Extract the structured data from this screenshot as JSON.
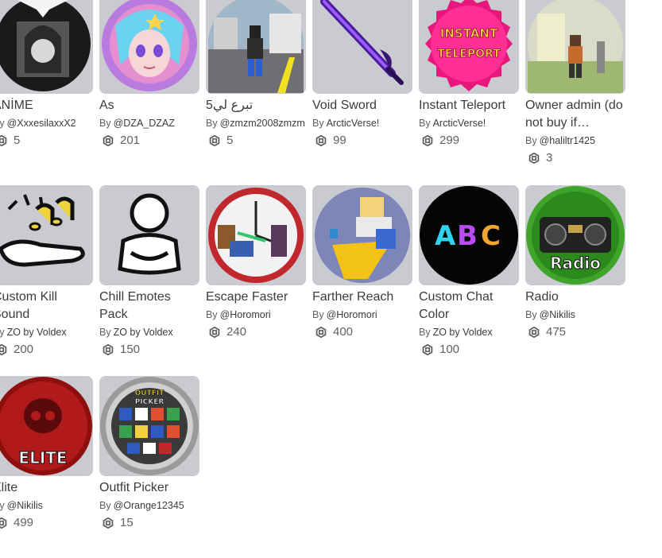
{
  "colors": {
    "thumb_bg": "#c9cbd1",
    "text_primary": "#393b3d",
    "text_secondary": "#606162"
  },
  "currency_icon": "robux-icon",
  "items": [
    {
      "title": "ANİME",
      "by": "By",
      "creator": "@XxxesilaxxX2",
      "price": "5",
      "thumb": "anime-girl-image"
    },
    {
      "title": "As",
      "by": "By",
      "creator": "@DZA_DZAZ",
      "price": "201",
      "thumb": "anime-portrait-image"
    },
    {
      "title": "تبرع لي5",
      "by": "By",
      "creator": "@zmzm2008zmzm",
      "price": "5",
      "thumb": "avatar-street-image"
    },
    {
      "title": "Void Sword",
      "by": "By",
      "creator": "ArcticVerse!",
      "price": "99",
      "thumb": "purple-sword-image"
    },
    {
      "title": "Instant Teleport",
      "by": "By",
      "creator": "ArcticVerse!",
      "price": "299",
      "thumb": "instant-teleport-badge",
      "badge_text": "INSTANT TELEPORT"
    },
    {
      "title": "Owner admin (do not buy if…",
      "by": "By",
      "creator": "@haliltr1425",
      "price": "3",
      "thumb": "owner-avatar-image"
    },
    {
      "title": "Custom Kill Sound",
      "by": "By",
      "creator": "ZO by Voldex",
      "price": "200",
      "thumb": "kill-sound-icon"
    },
    {
      "title": "Chill Emotes Pack",
      "by": "By",
      "creator": "ZO by Voldex",
      "price": "150",
      "thumb": "chill-emote-icon"
    },
    {
      "title": "Escape Faster",
      "by": "By",
      "creator": "@Horomori",
      "price": "240",
      "thumb": "clock-escape-image"
    },
    {
      "title": "Farther Reach",
      "by": "By",
      "creator": "@Horomori",
      "price": "400",
      "thumb": "reach-avatar-image"
    },
    {
      "title": "Custom Chat Color",
      "by": "By",
      "creator": "ZO by Voldex",
      "price": "100",
      "thumb": "abc-chat-badge",
      "badge_text": "ABC"
    },
    {
      "title": "Radio",
      "by": "By",
      "creator": "@Nikilis",
      "price": "475",
      "thumb": "radio-badge",
      "badge_text": "Radio"
    },
    {
      "title": "Elite",
      "by": "By",
      "creator": "@Nikilis",
      "price": "499",
      "thumb": "elite-skull-badge",
      "badge_text": "ELITE"
    },
    {
      "title": "Outfit Picker",
      "by": "By",
      "creator": "@Orange12345",
      "price": "15",
      "thumb": "outfit-picker-badge",
      "badge_text": "OUTFIT PICKER"
    }
  ]
}
